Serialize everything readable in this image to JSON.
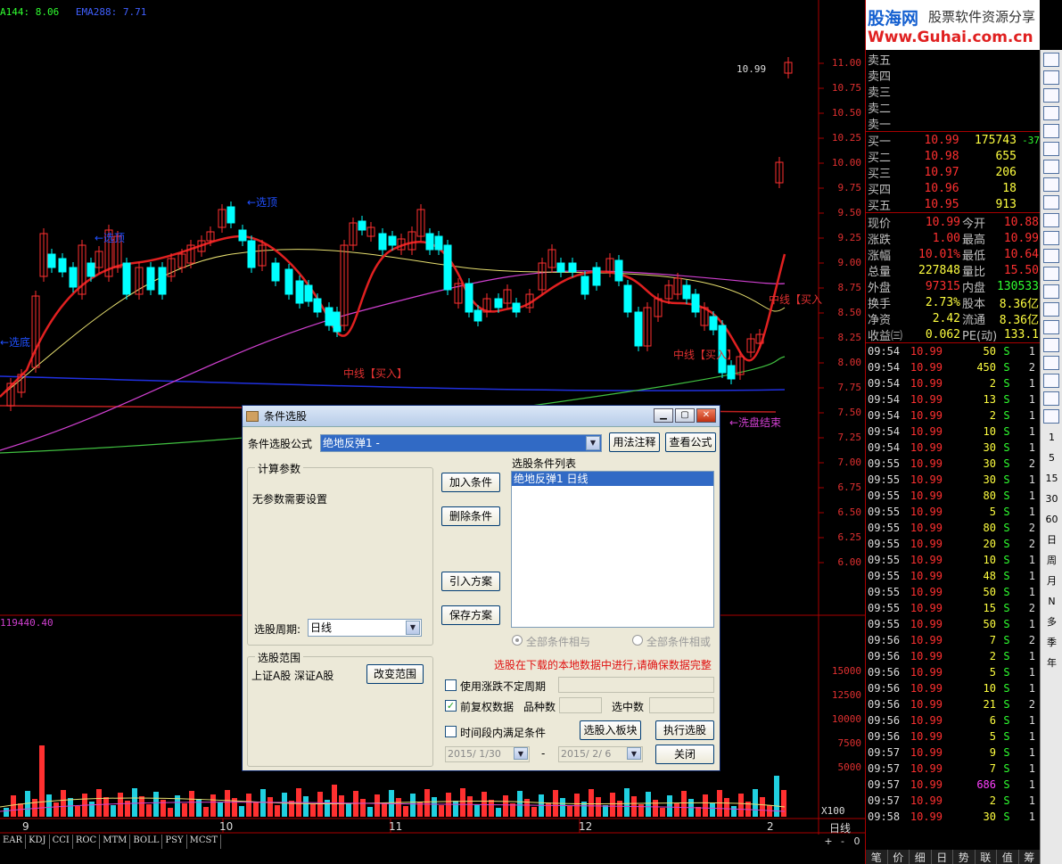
{
  "indicator_labels": {
    "ema144": "A144: 8.06",
    "ema288": "EMA288: 7.71"
  },
  "price_axis": [
    "11.00",
    "10.75",
    "10.50",
    "10.25",
    "10.00",
    "9.75",
    "9.50",
    "9.25",
    "9.00",
    "8.75",
    "8.50",
    "8.25",
    "8.00",
    "7.75",
    "7.50",
    "7.25",
    "7.00",
    "6.75",
    "6.50",
    "6.25",
    "6.00"
  ],
  "volume_axis": [
    "15000",
    "12500",
    "10000",
    "7500",
    "5000"
  ],
  "volume_multiplier": "X100",
  "volume_header": "119440.40",
  "annotations": {
    "xuanding1": "←选顶",
    "xuanding2": "←选顶",
    "xuandi": "←选底",
    "zhongxian1": "中线【买入】",
    "zhongxian2": "中线【买入】",
    "zhongxian3": "中线【买入",
    "xipan": "←洗盘结束",
    "high_price": "10.99"
  },
  "date_labels": [
    "9",
    "10",
    "11",
    "12",
    "2"
  ],
  "period_label": "日线",
  "indicator_tabs": [
    "EAR",
    "KDJ",
    "CCI",
    "ROC",
    "MTM",
    "BOLL",
    "PSY",
    "MCST"
  ],
  "chart_controls": [
    "+",
    "-",
    "0"
  ],
  "logo": {
    "name": "股海网",
    "slogan": "股票软件资源分享",
    "url": "Www.Guhai.com.cn"
  },
  "sell_orders": [
    "卖五",
    "卖四",
    "卖三",
    "卖二",
    "卖一"
  ],
  "buy_orders": [
    {
      "label": "买一",
      "price": "10.99",
      "vol": "175743",
      "extra": "-37"
    },
    {
      "label": "买二",
      "price": "10.98",
      "vol": "655",
      "extra": ""
    },
    {
      "label": "买三",
      "price": "10.97",
      "vol": "206",
      "extra": ""
    },
    {
      "label": "买四",
      "price": "10.96",
      "vol": "18",
      "extra": ""
    },
    {
      "label": "买五",
      "price": "10.95",
      "vol": "913",
      "extra": ""
    }
  ],
  "stats": [
    {
      "k1": "现价",
      "v1": "10.99",
      "k2": "今开",
      "v2": "10.88"
    },
    {
      "k1": "涨跌",
      "v1": "1.00",
      "k2": "最高",
      "v2": "10.99"
    },
    {
      "k1": "涨幅",
      "v1": "10.01%",
      "k2": "最低",
      "v2": "10.64"
    },
    {
      "k1": "总量",
      "v1": "227848",
      "k2": "量比",
      "v2": "15.50"
    },
    {
      "k1": "外盘",
      "v1": "97315",
      "k2": "内盘",
      "v2": "130533"
    },
    {
      "k1": "换手",
      "v1": "2.73%",
      "k2": "股本",
      "v2": "8.36亿"
    },
    {
      "k1": "净资",
      "v1": "2.42",
      "k2": "流通",
      "v2": "8.36亿"
    },
    {
      "k1": "收益㈢",
      "v1": "0.062",
      "k2": "PE(动)",
      "v2": "133.1"
    }
  ],
  "ticks": [
    {
      "t": "09:54",
      "p": "10.99",
      "q": "50",
      "s": "S",
      "n": "1"
    },
    {
      "t": "09:54",
      "p": "10.99",
      "q": "450",
      "s": "S",
      "n": "2"
    },
    {
      "t": "09:54",
      "p": "10.99",
      "q": "2",
      "s": "S",
      "n": "1"
    },
    {
      "t": "09:54",
      "p": "10.99",
      "q": "13",
      "s": "S",
      "n": "1"
    },
    {
      "t": "09:54",
      "p": "10.99",
      "q": "2",
      "s": "S",
      "n": "1"
    },
    {
      "t": "09:54",
      "p": "10.99",
      "q": "10",
      "s": "S",
      "n": "1"
    },
    {
      "t": "09:54",
      "p": "10.99",
      "q": "30",
      "s": "S",
      "n": "1"
    },
    {
      "t": "09:55",
      "p": "10.99",
      "q": "30",
      "s": "S",
      "n": "2"
    },
    {
      "t": "09:55",
      "p": "10.99",
      "q": "30",
      "s": "S",
      "n": "1"
    },
    {
      "t": "09:55",
      "p": "10.99",
      "q": "80",
      "s": "S",
      "n": "1"
    },
    {
      "t": "09:55",
      "p": "10.99",
      "q": "5",
      "s": "S",
      "n": "1"
    },
    {
      "t": "09:55",
      "p": "10.99",
      "q": "80",
      "s": "S",
      "n": "2"
    },
    {
      "t": "09:55",
      "p": "10.99",
      "q": "20",
      "s": "S",
      "n": "2"
    },
    {
      "t": "09:55",
      "p": "10.99",
      "q": "10",
      "s": "S",
      "n": "1"
    },
    {
      "t": "09:55",
      "p": "10.99",
      "q": "48",
      "s": "S",
      "n": "1"
    },
    {
      "t": "09:55",
      "p": "10.99",
      "q": "50",
      "s": "S",
      "n": "1"
    },
    {
      "t": "09:55",
      "p": "10.99",
      "q": "15",
      "s": "S",
      "n": "2"
    },
    {
      "t": "09:55",
      "p": "10.99",
      "q": "50",
      "s": "S",
      "n": "1"
    },
    {
      "t": "09:56",
      "p": "10.99",
      "q": "7",
      "s": "S",
      "n": "2"
    },
    {
      "t": "09:56",
      "p": "10.99",
      "q": "2",
      "s": "S",
      "n": "1"
    },
    {
      "t": "09:56",
      "p": "10.99",
      "q": "5",
      "s": "S",
      "n": "1"
    },
    {
      "t": "09:56",
      "p": "10.99",
      "q": "10",
      "s": "S",
      "n": "1"
    },
    {
      "t": "09:56",
      "p": "10.99",
      "q": "21",
      "s": "S",
      "n": "2"
    },
    {
      "t": "09:56",
      "p": "10.99",
      "q": "6",
      "s": "S",
      "n": "1"
    },
    {
      "t": "09:56",
      "p": "10.99",
      "q": "5",
      "s": "S",
      "n": "1"
    },
    {
      "t": "09:57",
      "p": "10.99",
      "q": "9",
      "s": "S",
      "n": "1"
    },
    {
      "t": "09:57",
      "p": "10.99",
      "q": "7",
      "s": "S",
      "n": "1"
    },
    {
      "t": "09:57",
      "p": "10.99",
      "q": "686",
      "s": "S",
      "n": "1"
    },
    {
      "t": "09:57",
      "p": "10.99",
      "q": "2",
      "s": "S",
      "n": "1"
    },
    {
      "t": "09:58",
      "p": "10.99",
      "q": "30",
      "s": "S",
      "n": "1"
    }
  ],
  "bottom_tabs": [
    "笔",
    "价",
    "细",
    "日",
    "势",
    "联",
    "值",
    "筹"
  ],
  "toolbar_text": [
    "1",
    "5",
    "15",
    "30",
    "60",
    "日",
    "周",
    "月",
    "N",
    "多",
    "季",
    "年"
  ],
  "toolbar_icons": [
    "arrow",
    "grid",
    "chart",
    "kline",
    "bars",
    "tick",
    "fin",
    "info",
    "box",
    "box2",
    "f10",
    "f2",
    "info2",
    "circle",
    "wave",
    "rsi",
    "line",
    "move",
    "pen",
    "f5",
    "page"
  ],
  "dialog": {
    "title": "条件选股",
    "formula_label": "条件选股公式",
    "formula_value": "绝地反弹1    -",
    "btn_usage": "用法注释",
    "btn_view": "查看公式",
    "params_group": "计算参数",
    "params_text": "无参数需要设置",
    "period_label": "选股周期:",
    "period_value": "日线",
    "btn_add": "加入条件",
    "btn_delete": "删除条件",
    "btn_import": "引入方案",
    "btn_save": "保存方案",
    "list_title": "选股条件列表",
    "list_items": [
      "绝地反弹1   日线"
    ],
    "radio_and": "全部条件相与",
    "radio_or": "全部条件相或",
    "warning": "选股在下载的本地数据中进行,请确保数据完整",
    "range_group": "选股范围",
    "range_text": "上证A股 深证A股",
    "btn_change_range": "改变范围",
    "chk_uncertain": "使用涨跌不定周期",
    "chk_adjust": "前复权数据",
    "count_label": "品种数",
    "selected_label": "选中数",
    "chk_period": "时间段内满足条件",
    "btn_to_block": "选股入板块",
    "btn_execute": "执行选股",
    "date_from": "2015/ 1/30",
    "date_dash": "-",
    "date_to": "2015/ 2/ 6",
    "btn_close": "关闭"
  },
  "colors": {
    "up": "#ff3030",
    "down": "#00ffff",
    "ma_red": "#e02020",
    "ma_yellow": "#e8e070",
    "ma_magenta": "#d040d0",
    "ma_blue": "#2030e0",
    "ma_green": "#40c040"
  }
}
